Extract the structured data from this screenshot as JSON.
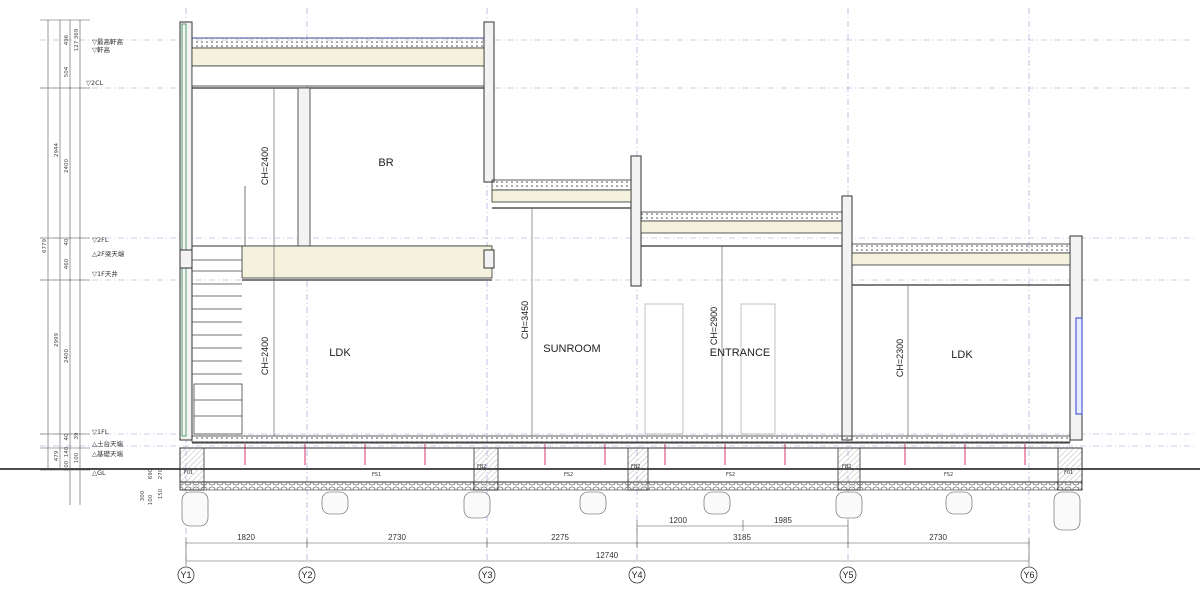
{
  "rooms": {
    "br": "BR",
    "ldk_1f": "LDK",
    "sunroom": "SUNROOM",
    "entrance": "ENTRANCE",
    "ldk_right": "LDK"
  },
  "ceiling_heights": {
    "br": "CH=2400",
    "ldk_1f": "CH=2400",
    "sunroom": "CH=3450",
    "entrance": "CH=2900",
    "ldk_right": "CH=2300"
  },
  "levels": {
    "max_eave": "▽最高軒高",
    "eave": "▽軒高",
    "cl2": "▽2CL",
    "fl2": "▽2FL",
    "beam2f": "△2F梁天端",
    "ceiling1f": "▽1F天井",
    "fl1": "▽1FL",
    "sill": "△土台天端",
    "foundation": "△基礎天端",
    "gl": "△GL"
  },
  "vertical_dims": {
    "outer": [
      "6779"
    ],
    "mid": [
      "2944",
      "2999",
      "479"
    ],
    "inner": [
      "496",
      "504",
      "2400",
      "40",
      "460",
      "2400",
      "40",
      "140",
      "300"
    ],
    "fine": [
      "369",
      "127",
      "39",
      "100"
    ],
    "lower": [
      "690",
      "270",
      "150",
      "100",
      "300"
    ]
  },
  "footing_tags": [
    "F01",
    "FS1",
    "FB2",
    "FS2",
    "FB2",
    "FS2",
    "FB2",
    "FS2",
    "F01"
  ],
  "span_dims_upper": [
    "1200",
    "1985"
  ],
  "span_dims_lower": [
    "1820",
    "2730",
    "2275",
    "3185",
    "2730"
  ],
  "total_dim": "12740",
  "grid_labels": [
    "Y1",
    "Y2",
    "Y3",
    "Y4",
    "Y5",
    "Y6"
  ],
  "colors": {
    "grid_line": "#9a9ad8",
    "insulation": "#d8306c",
    "glazing": "#2a3fd0",
    "roof_fill": "#f4f1dc"
  }
}
